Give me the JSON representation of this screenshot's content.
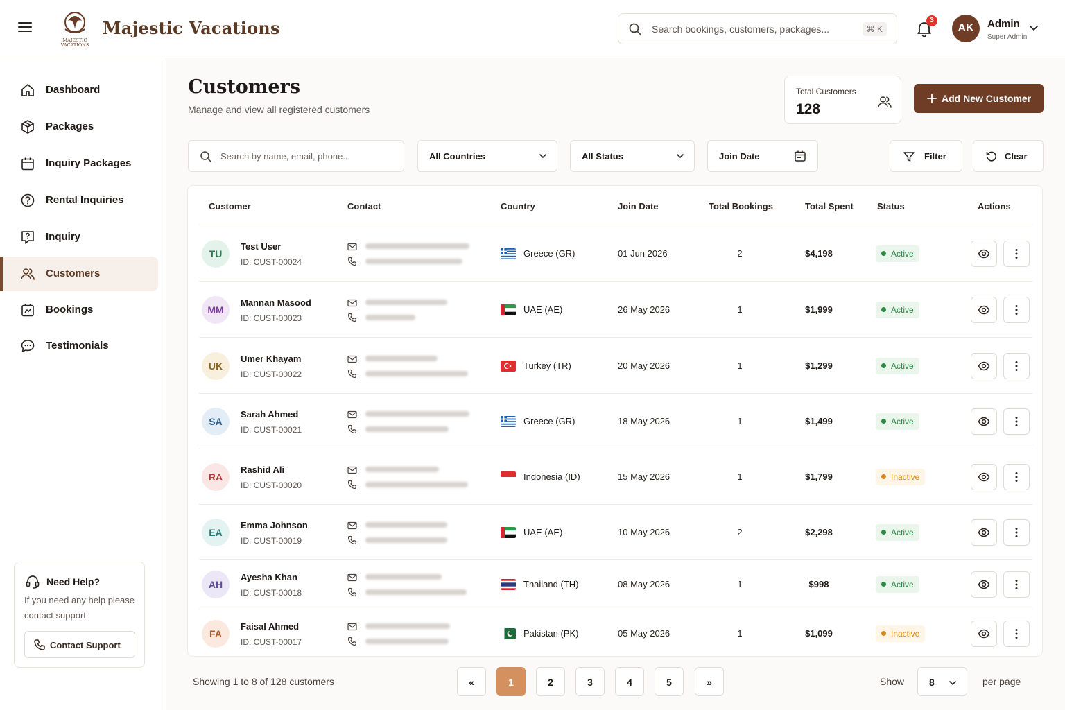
{
  "app": {
    "brand": "Majestic Vacations",
    "logo_text": "MAJESTIC VACATIONS",
    "search_placeholder": "Search bookings, customers, packages...",
    "search_shortcut": "⌘ K",
    "notifications_count": "3",
    "user": {
      "initials": "AK",
      "name": "Admin",
      "role": "Super Admin"
    }
  },
  "sidebar": {
    "items": [
      {
        "label": "Dashboard",
        "icon": "home-icon"
      },
      {
        "label": "Packages",
        "icon": "package-icon"
      },
      {
        "label": "Inquiry Packages",
        "icon": "calendar-icon"
      },
      {
        "label": "Rental Inquiries",
        "icon": "help-circle-icon"
      },
      {
        "label": "Inquiry",
        "icon": "help-square-icon"
      },
      {
        "label": "Customers",
        "icon": "users-icon"
      },
      {
        "label": "Bookings",
        "icon": "bookings-icon"
      },
      {
        "label": "Testimonials",
        "icon": "chat-icon"
      }
    ],
    "active": "Customers",
    "help": {
      "title": "Need Help?",
      "text": "If you need any help please contact support",
      "button": "Contact Support"
    }
  },
  "header": {
    "title": "Customers",
    "subtitle": "Manage and view all registered customers",
    "stat_label": "Total Customers",
    "stat_value": "128",
    "add_button": "Add New Customer"
  },
  "filters": {
    "search_placeholder": "Search by name, email, phone...",
    "country": "All Countries",
    "status": "All Status",
    "join_date": "Join Date",
    "filter_button": "Filter",
    "clear_button": "Clear"
  },
  "table": {
    "columns": [
      "Customer",
      "Contact",
      "Country",
      "Join Date",
      "Total Bookings",
      "Total Spent",
      "Status",
      "Actions"
    ],
    "rows": [
      {
        "initials": "TU",
        "name": "Test User",
        "id": "ID: CUST-00024",
        "country": "Greece (GR)",
        "flag": "gr",
        "join_date": "01 Jun 2026",
        "bookings": "2",
        "spent": "$4,198",
        "status": "Active",
        "avatar_bg": "#e3f2ea",
        "avatar_fg": "#2f7a52"
      },
      {
        "initials": "MM",
        "name": "Mannan Masood",
        "id": "ID: CUST-00023",
        "country": "UAE (AE)",
        "flag": "ae",
        "join_date": "26 May 2026",
        "bookings": "1",
        "spent": "$1,999",
        "status": "Active",
        "avatar_bg": "#f0e6f5",
        "avatar_fg": "#7b3f9a"
      },
      {
        "initials": "UK",
        "name": "Umer Khayam",
        "id": "ID: CUST-00022",
        "country": "Turkey (TR)",
        "flag": "tr",
        "join_date": "20 May 2026",
        "bookings": "1",
        "spent": "$1,299",
        "status": "Active",
        "avatar_bg": "#f8efdd",
        "avatar_fg": "#8a6420"
      },
      {
        "initials": "SA",
        "name": "Sarah Ahmed",
        "id": "ID: CUST-00021",
        "country": "Greece (GR)",
        "flag": "gr",
        "join_date": "18 May 2026",
        "bookings": "1",
        "spent": "$1,499",
        "status": "Active",
        "avatar_bg": "#e3edf7",
        "avatar_fg": "#2e5d8a"
      },
      {
        "initials": "RA",
        "name": "Rashid Ali",
        "id": "ID: CUST-00020",
        "country": "Indonesia (ID)",
        "flag": "id",
        "join_date": "15 May 2026",
        "bookings": "1",
        "spent": "$1,799",
        "status": "Inactive",
        "avatar_bg": "#fbe6e6",
        "avatar_fg": "#b03a3a"
      },
      {
        "initials": "EA",
        "name": "Emma Johnson",
        "id": "ID: CUST-00019",
        "country": "UAE (AE)",
        "flag": "ae",
        "join_date": "10 May 2026",
        "bookings": "2",
        "spent": "$2,298",
        "status": "Active",
        "avatar_bg": "#e2f3f1",
        "avatar_fg": "#2b7a72"
      },
      {
        "initials": "AH",
        "name": "Ayesha Khan",
        "id": "ID: CUST-00018",
        "country": "Thailand (TH)",
        "flag": "th",
        "join_date": "08 May 2026",
        "bookings": "1",
        "spent": "$998",
        "status": "Active",
        "avatar_bg": "#ece7f6",
        "avatar_fg": "#5b4a92"
      },
      {
        "initials": "FA",
        "name": "Faisal Ahmed",
        "id": "ID: CUST-00017",
        "country": "Pakistan (PK)",
        "flag": "pk",
        "join_date": "05 May 2026",
        "bookings": "1",
        "spent": "$1,099",
        "status": "Inactive",
        "avatar_bg": "#fbe9df",
        "avatar_fg": "#b05a2a"
      }
    ]
  },
  "pagination": {
    "showing": "Showing 1 to 8 of 128 customers",
    "first": "«",
    "last": "»",
    "pages": [
      "1",
      "2",
      "3",
      "4",
      "5"
    ],
    "current": "1",
    "show_label": "Show",
    "per_page_value": "8",
    "per_page_label": "per page"
  }
}
